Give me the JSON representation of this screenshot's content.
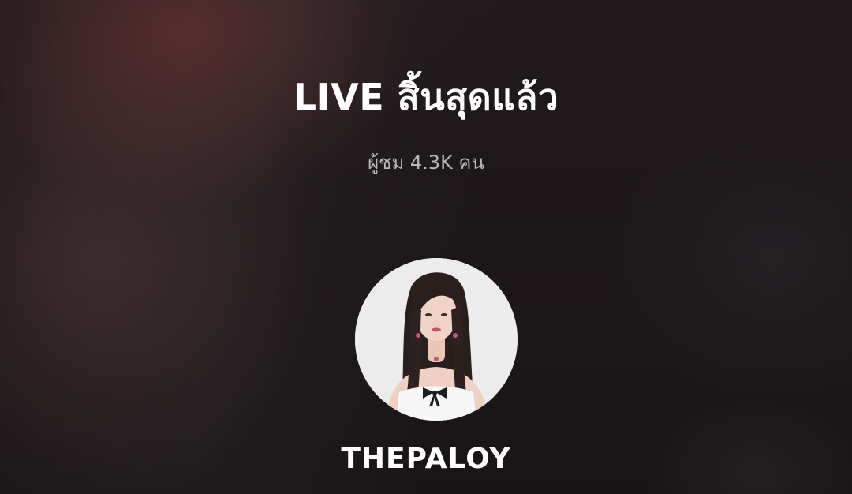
{
  "live_ended": {
    "title": "LIVE สิ้นสุดแล้ว",
    "viewers_text": "ผู้ชม 4.3K คน"
  },
  "host": {
    "avatar_icon": "host-profile-photo",
    "username": "THEPALOY"
  },
  "colors": {
    "background": "#1a1517",
    "title": "#ffffff",
    "subtitle": "#b9b6b7",
    "avatar_bg": "#ececec"
  }
}
